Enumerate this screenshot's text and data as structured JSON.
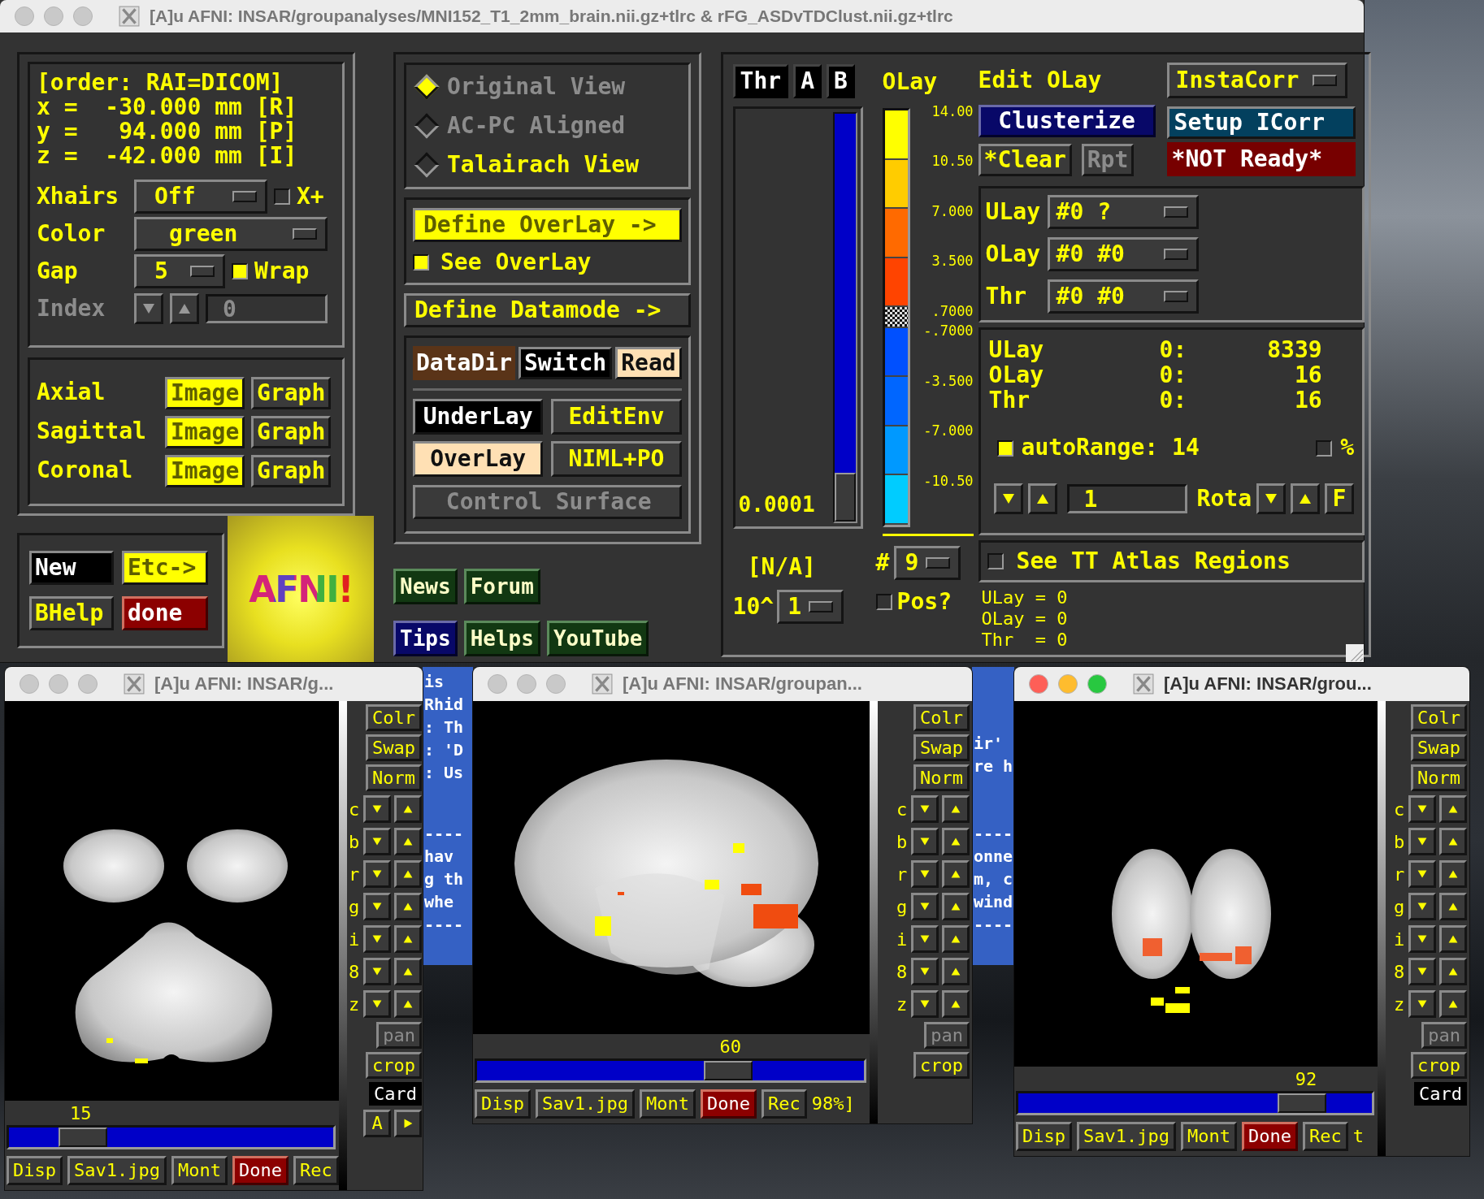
{
  "main_window": {
    "title": "[A]u AFNI: INSAR/groupanalyses/MNI152_T1_2mm_brain.nii.gz+tlrc & rFG_ASDvTDClust.nii.gz+tlrc",
    "active": false
  },
  "coords": [
    "[order: RAI=DICOM]",
    "x =  -30.000 mm [R]",
    "y =   94.000 mm [P]",
    "z =  -42.000 mm [I]"
  ],
  "xhairs": {
    "label": "Xhairs",
    "value": "Off",
    "plus": {
      "label": "X+",
      "checked": false
    }
  },
  "color": {
    "label": "Color",
    "value": "green"
  },
  "gap": {
    "label": "Gap",
    "value": "5",
    "wrap": {
      "label": "Wrap",
      "checked": true
    }
  },
  "index": {
    "label": "Index",
    "value": "0",
    "disabled": true
  },
  "views": [
    {
      "label": "Axial",
      "image": "Image",
      "graph": "Graph"
    },
    {
      "label": "Sagittal",
      "image": "Image",
      "graph": "Graph"
    },
    {
      "label": "Coronal",
      "image": "Image",
      "graph": "Graph"
    }
  ],
  "bottom_buttons": [
    {
      "label": "New",
      "kind": "dark"
    },
    {
      "label": "Etc->",
      "kind": "yellow"
    },
    {
      "label": "BHelp",
      "kind": "plain"
    },
    {
      "label": "done",
      "kind": "red"
    }
  ],
  "logo": "AFNI!",
  "view_modes": [
    {
      "label": "Original View",
      "selected": true,
      "disabled": true
    },
    {
      "label": "AC-PC Aligned",
      "selected": false,
      "disabled": true
    },
    {
      "label": "Talairach View",
      "selected": false,
      "disabled": false
    }
  ],
  "define_overlay": "Define OverLay ->",
  "see_overlay": {
    "label": "See OverLay",
    "checked": true
  },
  "define_datamode": "Define Datamode ->",
  "datadir": {
    "label": "DataDir",
    "switch": "Switch",
    "read": "Read"
  },
  "data_buttons": [
    {
      "label": "UnderLay",
      "kind": "dark"
    },
    {
      "label": "EditEnv",
      "kind": "plain"
    },
    {
      "label": "OverLay",
      "kind": "peach"
    },
    {
      "label": "NIML+PO",
      "kind": "plain"
    }
  ],
  "control_surface": {
    "label": "Control Surface",
    "disabled": true
  },
  "links": [
    {
      "label": "News",
      "kind": "green"
    },
    {
      "label": "Forum",
      "kind": "green"
    },
    {
      "label": "Tips",
      "kind": "navy"
    },
    {
      "label": "Helps",
      "kind": "green"
    },
    {
      "label": "YouTube",
      "kind": "green"
    }
  ],
  "threshold": {
    "buttons": [
      "Thr",
      "A",
      "B"
    ],
    "level": 0,
    "value": "0.0001",
    "pvalue": "[N/A]",
    "scale_label": "10^",
    "scale_value": "1"
  },
  "olay_bar": {
    "label": "OLay",
    "segments": [
      {
        "kind": "solid",
        "color": "#ffff00",
        "label": "14.00"
      },
      {
        "kind": "solid",
        "color": "#ffcc00",
        "label": "10.50"
      },
      {
        "kind": "solid",
        "color": "#ff6a00",
        "label": "7.000"
      },
      {
        "kind": "solid",
        "color": "#ff4400",
        "label": "3.500"
      },
      {
        "kind": "checker",
        "label": ".7000"
      },
      {
        "kind": "solid",
        "color": "#0050ff",
        "label": "-.7000"
      },
      {
        "kind": "solid",
        "color": "#0066ff",
        "label": "-3.500"
      },
      {
        "kind": "solid",
        "color": "#0099ff",
        "label": "-7.000"
      },
      {
        "kind": "solid",
        "color": "#00ccff",
        "label": "-10.50"
      }
    ],
    "panes_label": "#",
    "panes": "9",
    "pos": {
      "label": "Pos?",
      "checked": false
    }
  },
  "edit_olay": "Edit OLay",
  "clusterize": "Clusterize",
  "clear": "*Clear",
  "rpt": {
    "label": "Rpt",
    "disabled": true
  },
  "instacorr": "InstaCorr",
  "setup_icorr": "Setup ICorr",
  "not_ready": "*NOT Ready*",
  "selectors": [
    {
      "label": "ULay",
      "value": "#0 ?"
    },
    {
      "label": "OLay",
      "value": "#0 #0"
    },
    {
      "label": "Thr",
      "value": "#0 #0"
    }
  ],
  "stats": [
    {
      "label": "ULay",
      "index": "0:",
      "value": "8339"
    },
    {
      "label": "OLay",
      "index": "0:",
      "value": "16"
    },
    {
      "label": "Thr",
      "index": "0:",
      "value": "16"
    }
  ],
  "autorange": {
    "label": "autoRange: 14",
    "checked": true
  },
  "percent": {
    "label": "%",
    "checked": false
  },
  "rota": {
    "value": "1",
    "label": "Rota",
    "f": "F"
  },
  "atlas": {
    "label": "See TT Atlas Regions",
    "checked": false
  },
  "info": [
    "ULay = 0",
    "OLay = 0",
    "Thr  = 0"
  ],
  "terminal_strips": [
    {
      "top": [
        "is",
        "Rhid",
        ": Th",
        ": 'D",
        ": Us"
      ],
      "bottom": [
        "----",
        "hav",
        "g th",
        "whe",
        "----"
      ]
    },
    {
      "top": [
        "ir'",
        "re h"
      ],
      "bottom": [
        "----",
        "onne",
        "m, c",
        "wind",
        "----"
      ]
    }
  ],
  "image_windows": [
    {
      "title": "[A]u AFNI: INSAR/g...",
      "active": false,
      "kind": "axial",
      "slice": "15",
      "level": 0.18,
      "side_buttons": [
        "Colr",
        "Swap",
        "Norm"
      ],
      "arrow_rows": [
        "c",
        "b",
        "r",
        "g",
        "i",
        "8",
        "z"
      ],
      "pan": {
        "label": "pan",
        "disabled": true
      },
      "crop": "crop",
      "tooltip": "Card",
      "side_extra": "A",
      "buttons": [
        {
          "label": "Disp",
          "kind": "plain"
        },
        {
          "label": "Sav1.jpg",
          "kind": "plain"
        },
        {
          "label": "Mont",
          "kind": "plain"
        },
        {
          "label": "Done",
          "kind": "red"
        },
        {
          "label": "Rec",
          "kind": "plain"
        }
      ]
    },
    {
      "title": "[A]u AFNI: INSAR/groupan...",
      "active": false,
      "kind": "sagittal",
      "slice": "60",
      "level": 0.67,
      "side_buttons": [
        "Colr",
        "Swap",
        "Norm"
      ],
      "arrow_rows": [
        "c",
        "b",
        "r",
        "g",
        "i",
        "8",
        "z"
      ],
      "pan": {
        "label": "pan",
        "disabled": true
      },
      "crop": "crop",
      "trailing": "98%]",
      "buttons": [
        {
          "label": "Disp",
          "kind": "plain"
        },
        {
          "label": "Sav1.jpg",
          "kind": "plain"
        },
        {
          "label": "Mont",
          "kind": "plain"
        },
        {
          "label": "Done",
          "kind": "red"
        },
        {
          "label": "Rec",
          "kind": "plain"
        }
      ]
    },
    {
      "title": "[A]u AFNI: INSAR/grou...",
      "active": true,
      "kind": "coronal",
      "slice": "92",
      "level": 0.85,
      "side_buttons": [
        "Colr",
        "Swap",
        "Norm"
      ],
      "arrow_rows": [
        "c",
        "b",
        "r",
        "g",
        "i",
        "8",
        "z"
      ],
      "pan": {
        "label": "pan",
        "disabled": true
      },
      "crop": "crop",
      "tooltip": "Card",
      "trailing": "t",
      "buttons": [
        {
          "label": "Disp",
          "kind": "plain"
        },
        {
          "label": "Sav1.jpg",
          "kind": "plain"
        },
        {
          "label": "Mont",
          "kind": "plain"
        },
        {
          "label": "Done",
          "kind": "red"
        },
        {
          "label": "Rec",
          "kind": "plain"
        }
      ]
    }
  ]
}
